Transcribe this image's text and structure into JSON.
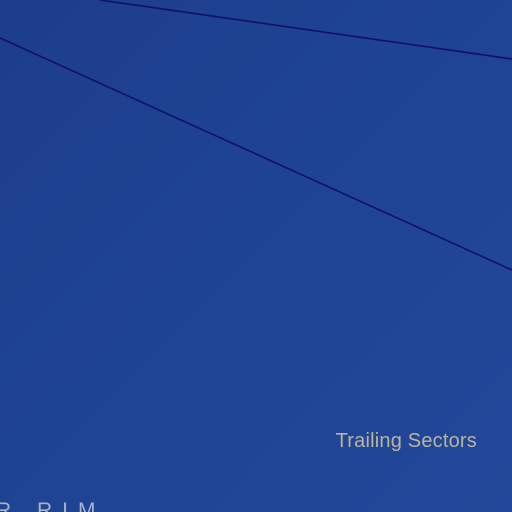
{
  "labels": {
    "sector_caption": "Trailing Sectors",
    "bottom_caption": "R RIM"
  },
  "colors": {
    "background": "#1f4393",
    "line": "#120f6c",
    "caption": "#b7b59a"
  }
}
